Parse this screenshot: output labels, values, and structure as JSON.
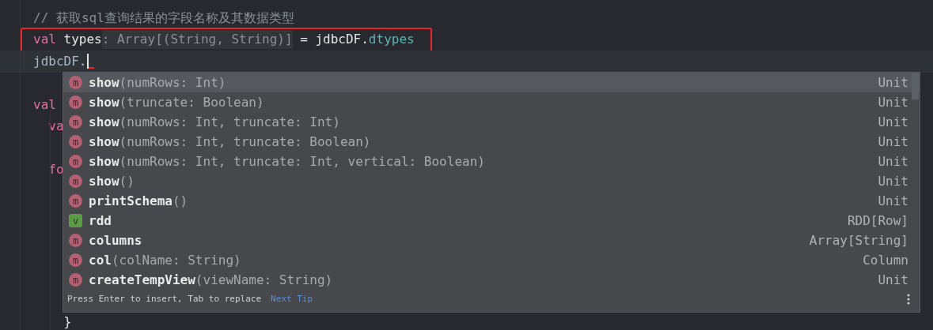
{
  "code_lines": [
    {
      "kind": "code",
      "tokens": [
        {
          "kind": "comment",
          "text": "// 获取sql查询结果的字段名称及其数据类型"
        }
      ]
    },
    {
      "kind": "boxed",
      "tokens": [
        {
          "kind": "keyword",
          "text": "val"
        },
        {
          "kind": "plain",
          "text": " types"
        },
        {
          "kind": "hint",
          "text": ": Array[(String, String)]"
        },
        {
          "kind": "plain",
          "text": " = jdbcDF."
        },
        {
          "kind": "member",
          "text": "dtypes"
        }
      ]
    },
    {
      "kind": "current",
      "tokens": [
        {
          "kind": "ident",
          "text": "jdbcDF."
        }
      ]
    },
    {
      "kind": "blank"
    },
    {
      "kind": "code",
      "tokens": [
        {
          "kind": "keyword",
          "text": "val"
        }
      ]
    },
    {
      "kind": "code",
      "tokens": [
        {
          "kind": "keyword",
          "text": "  va"
        }
      ]
    },
    {
      "kind": "blank"
    },
    {
      "kind": "code",
      "tokens": [
        {
          "kind": "keyword",
          "text": "  fo"
        }
      ]
    },
    {
      "kind": "blank"
    },
    {
      "kind": "blank"
    },
    {
      "kind": "blank"
    },
    {
      "kind": "blank"
    },
    {
      "kind": "blank"
    },
    {
      "kind": "blank"
    },
    {
      "kind": "code",
      "tokens": [
        {
          "kind": "plain",
          "text": "    }"
        }
      ]
    }
  ],
  "completion": {
    "items": [
      {
        "kind": "method",
        "icon": "m",
        "name": "show",
        "params": "(numRows: Int)",
        "type": "Unit",
        "selected": true
      },
      {
        "kind": "method",
        "icon": "m",
        "name": "show",
        "params": "(truncate: Boolean)",
        "type": "Unit",
        "selected": false
      },
      {
        "kind": "method",
        "icon": "m",
        "name": "show",
        "params": "(numRows: Int, truncate: Int)",
        "type": "Unit",
        "selected": false
      },
      {
        "kind": "method",
        "icon": "m",
        "name": "show",
        "params": "(numRows: Int, truncate: Boolean)",
        "type": "Unit",
        "selected": false
      },
      {
        "kind": "method",
        "icon": "m",
        "name": "show",
        "params": "(numRows: Int, truncate: Int, vertical: Boolean)",
        "type": "Unit",
        "selected": false
      },
      {
        "kind": "method",
        "icon": "m",
        "name": "show",
        "params": "()",
        "type": "Unit",
        "selected": false
      },
      {
        "kind": "method",
        "icon": "m",
        "name": "printSchema",
        "params": "()",
        "type": "Unit",
        "selected": false
      },
      {
        "kind": "value",
        "icon": "v",
        "name": "rdd",
        "type": "RDD[Row]",
        "selected": false
      },
      {
        "kind": "method",
        "icon": "m",
        "name": "columns",
        "type": "Array[String]",
        "selected": false
      },
      {
        "kind": "method",
        "icon": "m",
        "name": "col",
        "params": "(colName: String)",
        "type": "Column",
        "selected": false
      },
      {
        "kind": "method",
        "icon": "m",
        "name": "createTempView",
        "params": "(viewName: String)",
        "type": "Unit",
        "selected": false
      }
    ],
    "hint": "Press Enter to insert, Tab to replace",
    "link": "Next Tip"
  }
}
